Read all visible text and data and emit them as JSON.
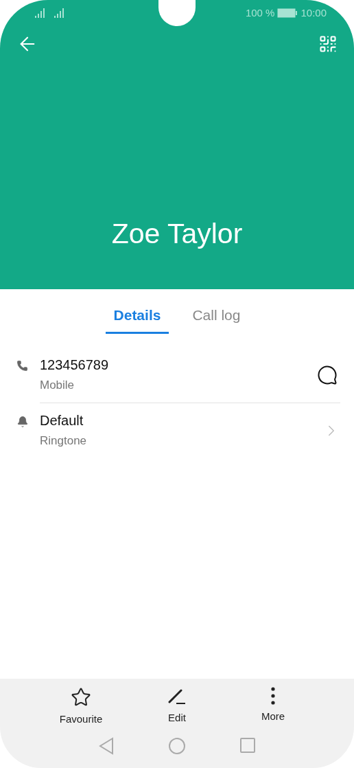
{
  "status_bar": {
    "battery": "100 %",
    "time": "10:00"
  },
  "contact": {
    "name": "Zoe Taylor"
  },
  "tabs": [
    {
      "label": "Details",
      "selected": true
    },
    {
      "label": "Call log",
      "selected": false
    }
  ],
  "details": [
    {
      "kind": "phone",
      "value": "123456789",
      "label": "Mobile"
    },
    {
      "kind": "ringtone",
      "value": "Default",
      "label": "Ringtone"
    }
  ],
  "actions": [
    {
      "kind": "favourite",
      "label": "Favourite"
    },
    {
      "kind": "edit",
      "label": "Edit"
    },
    {
      "kind": "more",
      "label": "More"
    }
  ]
}
